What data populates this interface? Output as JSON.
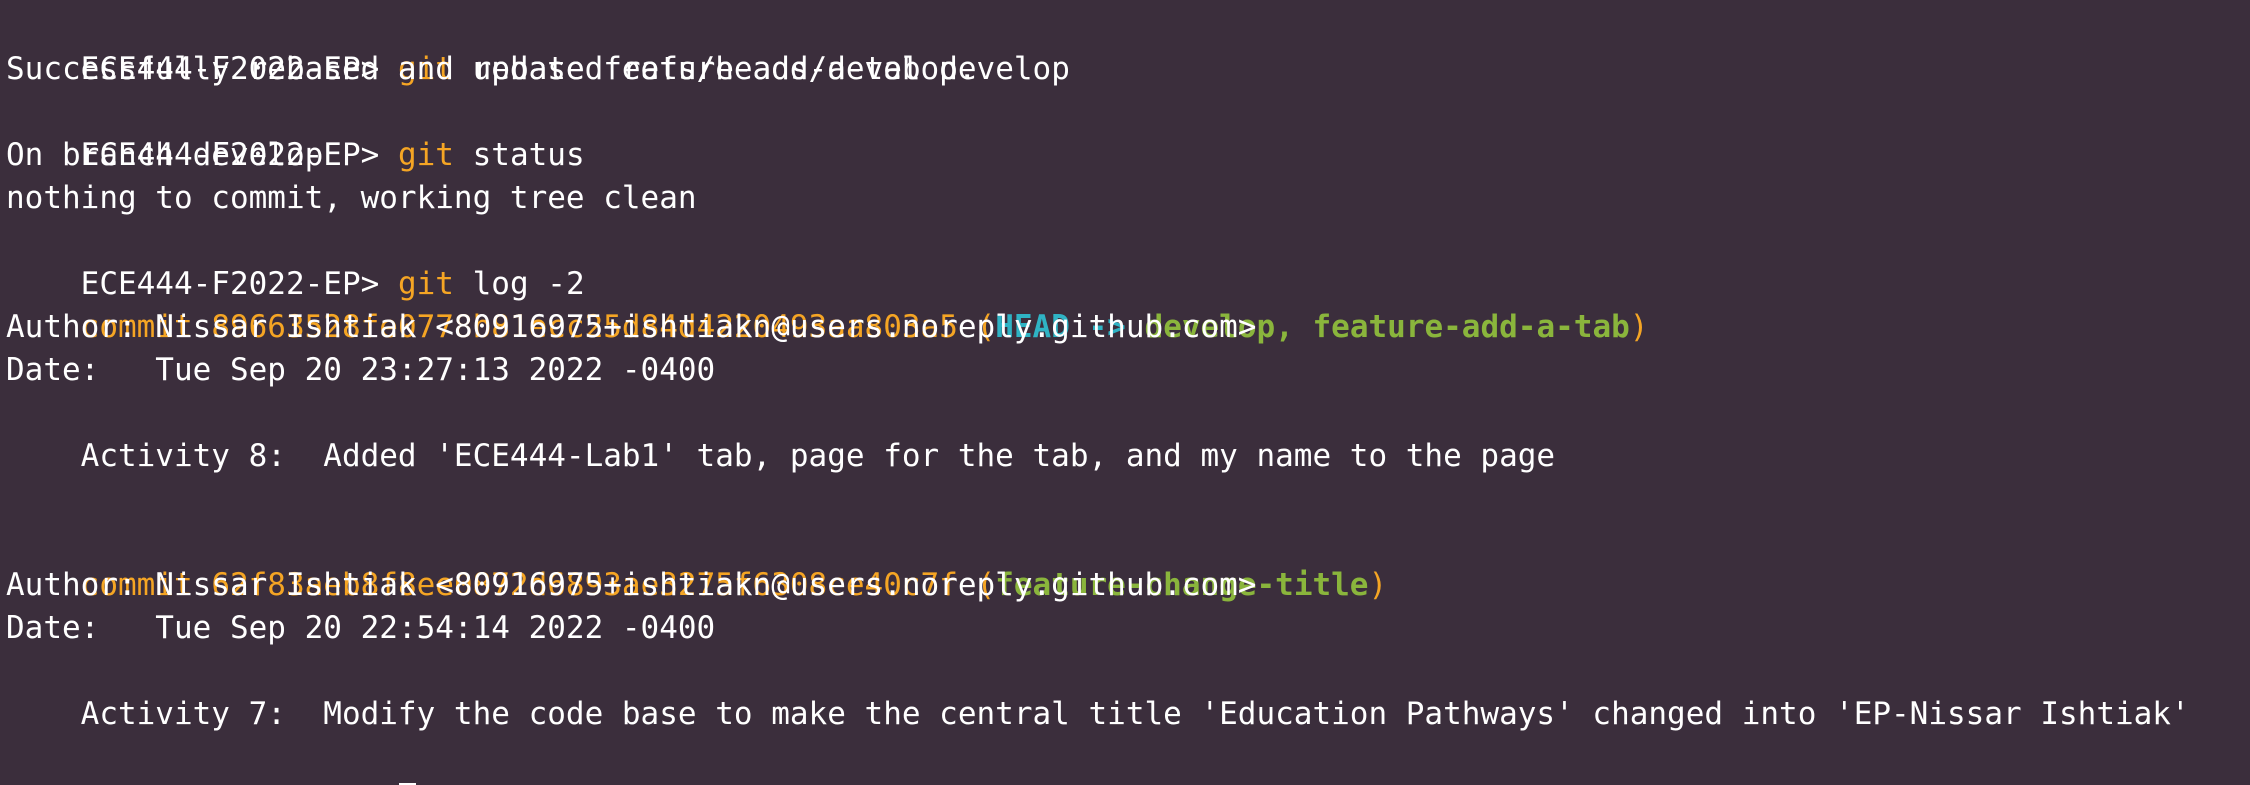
{
  "prompt": "ECE444-F2022-EP>",
  "commands": [
    {
      "program": "git",
      "args": "rebase feature-add-a-tab develop"
    },
    {
      "program": "git",
      "args": "status"
    },
    {
      "program": "git",
      "args": "log -2"
    }
  ],
  "outputs": {
    "rebase": "Successfully rebased and updated refs/heads/develop.",
    "status_branch": "On branch develop",
    "status_clean": "nothing to commit, working tree clean"
  },
  "commits": [
    {
      "label": "commit",
      "hash": "89663528fe0778b81ecc25d84d4220493aa803a5",
      "refs": {
        "open": "(",
        "head": "HEAD ->",
        "branch": "develop, feature-add-a-tab",
        "close": ")"
      },
      "author": "Author: Nissar Ishtiak <80916975+ishtiakn@users.noreply.github.com>",
      "date": "Date:   Tue Sep 20 23:27:13 2022 -0400",
      "message": "    Activity 8:  Added 'ECE444-Lab1' tab, page for the tab, and my name to the page"
    },
    {
      "label": "commit",
      "hash": "62f83aeb8f8ee0872d6893ae3275f6308ce40c7f",
      "refs": {
        "open": "(",
        "branch": "feature-change-title",
        "close": ")"
      },
      "author": "Author: Nissar Ishtiak <80916975+ishtiakn@users.noreply.github.com>",
      "date": "Date:   Tue Sep 20 22:54:14 2022 -0400",
      "message": "    Activity 7:  Modify the code base to make the central title 'Education Pathways' changed into 'EP-Nissar Ishtiak'"
    }
  ],
  "colors": {
    "background": "#3b2e3c",
    "text": "#ffffff",
    "command": "#f5a524",
    "head": "#2fb3c4",
    "branch": "#8ab53c"
  }
}
